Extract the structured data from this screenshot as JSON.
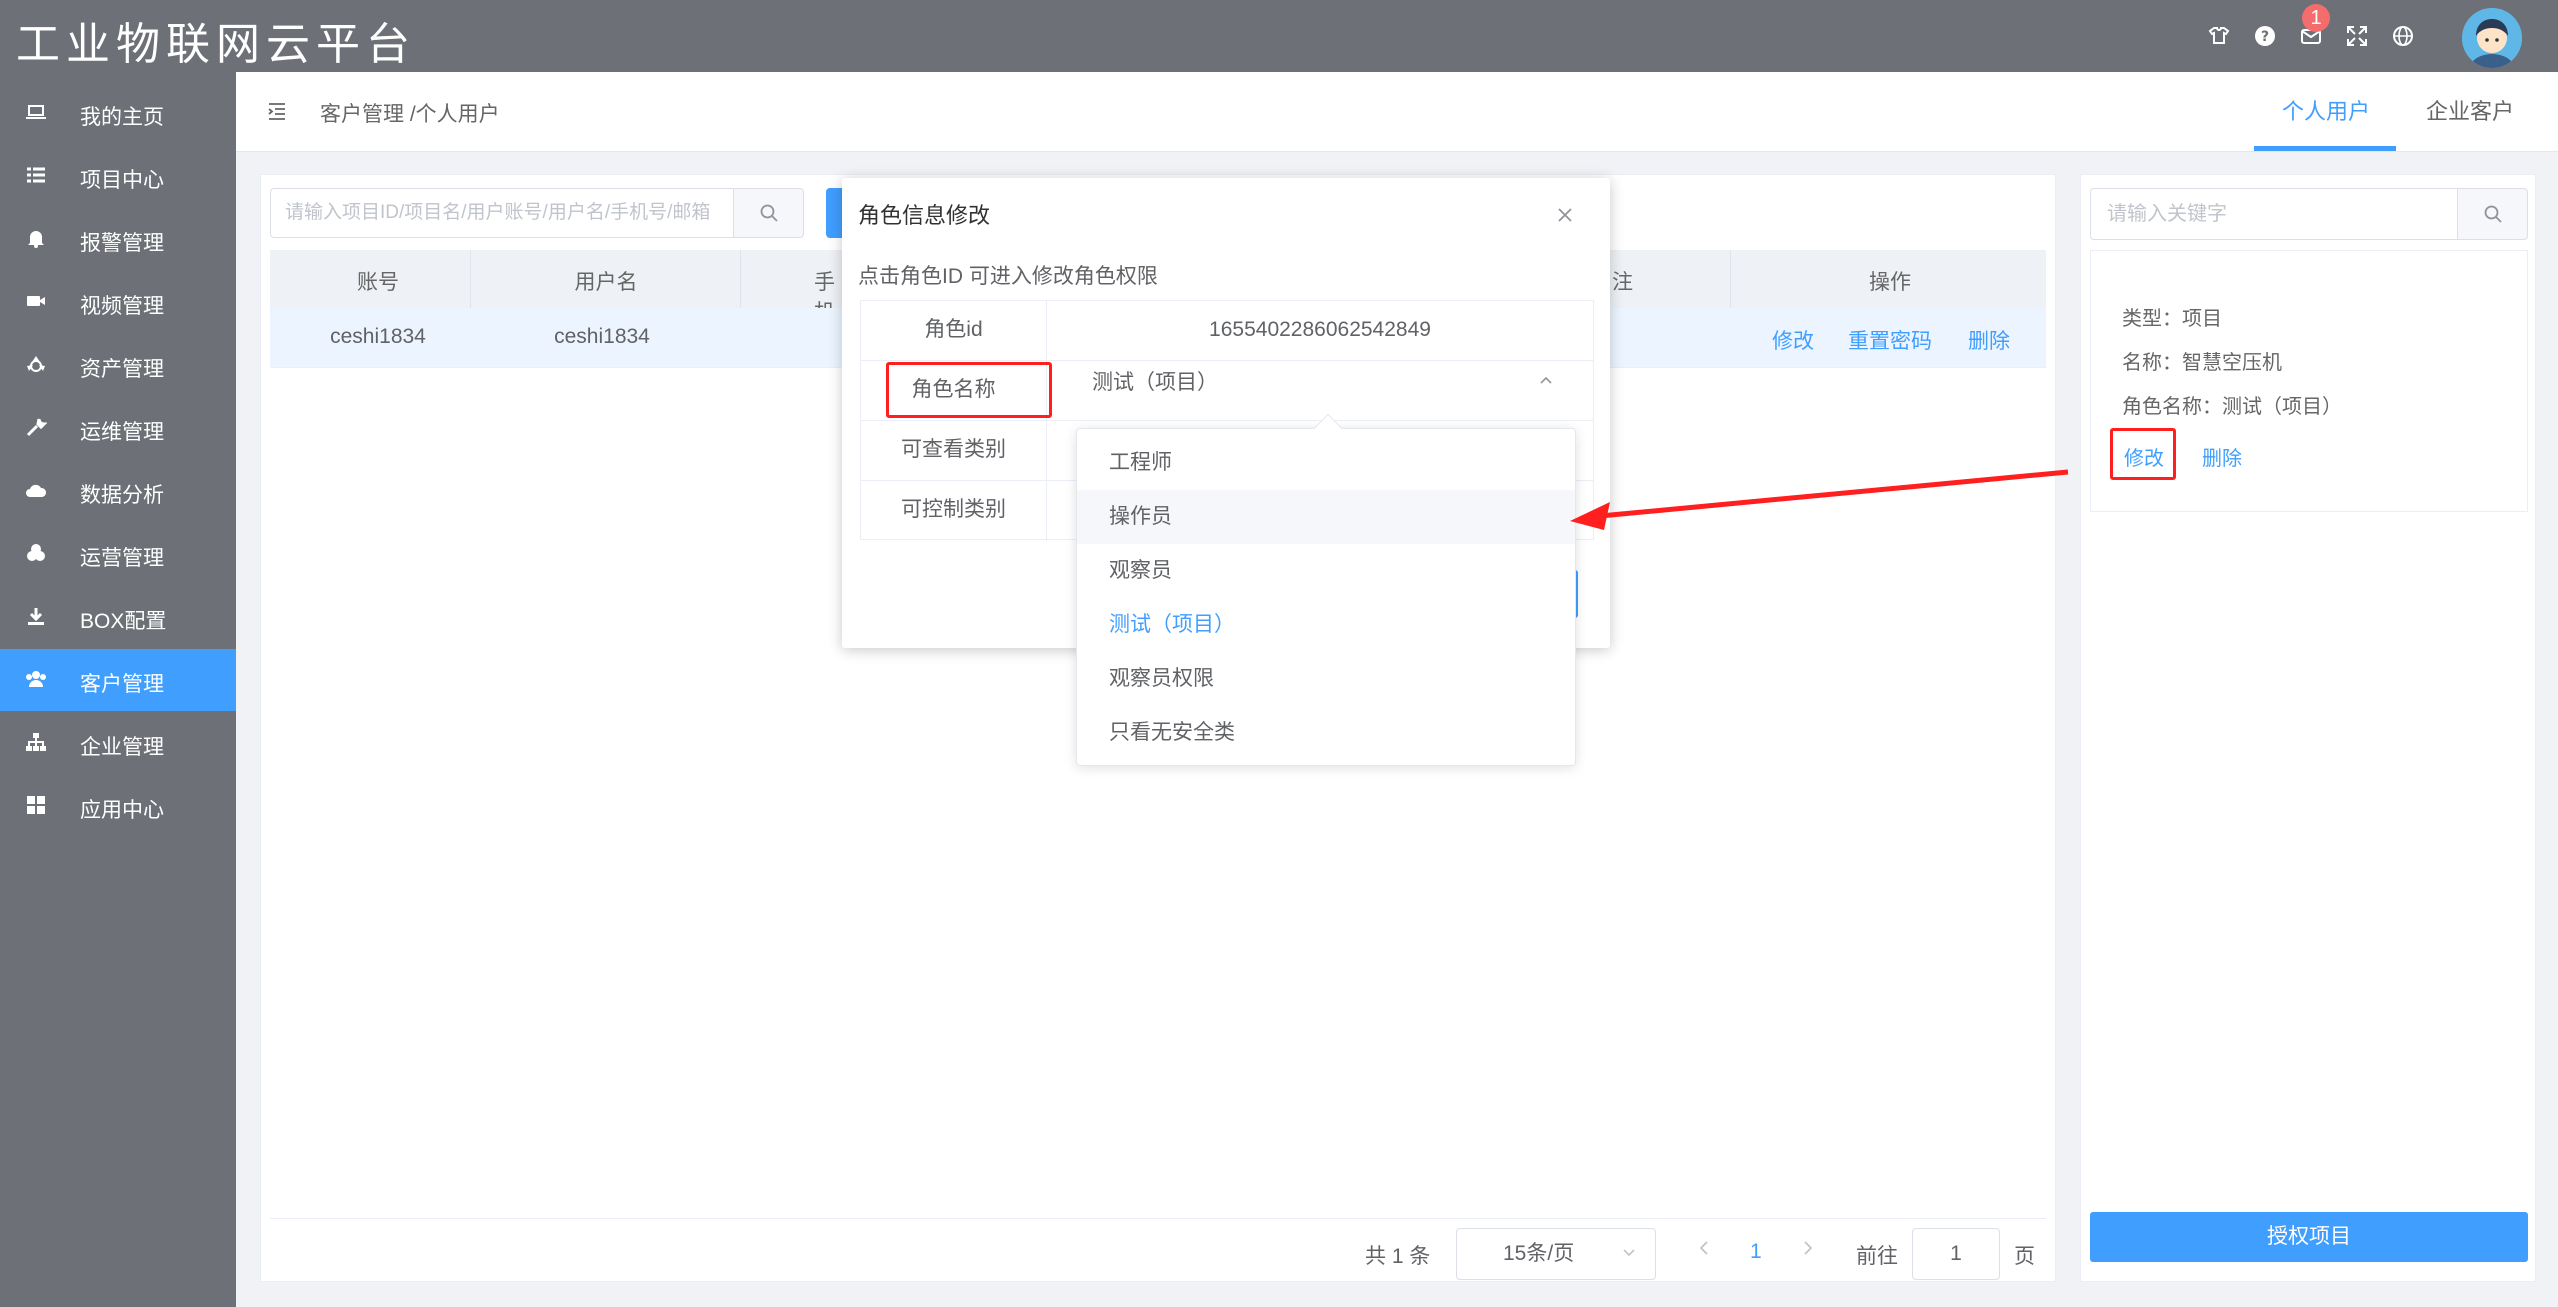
{
  "app": {
    "title": "工业物联网云平台",
    "notification_count": "1"
  },
  "sidebar": {
    "items": [
      {
        "label": "我的主页",
        "icon": "laptop-icon"
      },
      {
        "label": "项目中心",
        "icon": "list-icon"
      },
      {
        "label": "报警管理",
        "icon": "bell-icon"
      },
      {
        "label": "视频管理",
        "icon": "video-icon"
      },
      {
        "label": "资产管理",
        "icon": "recycle-icon"
      },
      {
        "label": "运维管理",
        "icon": "wrench-icon"
      },
      {
        "label": "数据分析",
        "icon": "cloud-chart-icon"
      },
      {
        "label": "运营管理",
        "icon": "cubes-icon"
      },
      {
        "label": "BOX配置",
        "icon": "download-icon"
      },
      {
        "label": "客户管理",
        "icon": "users-icon",
        "active": true
      },
      {
        "label": "企业管理",
        "icon": "sitemap-icon"
      },
      {
        "label": "应用中心",
        "icon": "grid-icon"
      }
    ]
  },
  "topbar": {
    "breadcrumb": "客户管理 /个人用户",
    "tabs": [
      "个人用户",
      "企业客户"
    ]
  },
  "search": {
    "placeholder": "请输入项目ID/项目名/用户账号/用户名/手机号/邮箱"
  },
  "table": {
    "columns": [
      "账号",
      "用户名",
      "手机",
      "注",
      "操作"
    ],
    "rows": [
      {
        "account": "ceshi1834",
        "username": "ceshi1834",
        "actions": [
          "修改",
          "重置密码",
          "删除"
        ]
      }
    ]
  },
  "pagination": {
    "total": "共 1 条",
    "page_size": "15条/页",
    "current": "1",
    "goto_label": "前往",
    "goto_value": "1",
    "page_suffix": "页"
  },
  "right_panel": {
    "search_placeholder": "请输入关键字",
    "type": "类型：项目",
    "name": "名称：智慧空压机",
    "role_name": "角色名称：测试（项目）",
    "edit": "修改",
    "delete": "删除",
    "authorize_button": "授权项目"
  },
  "dialog": {
    "title": "角色信息修改",
    "hint": "点击角色ID 可进入修改角色权限",
    "rows": [
      {
        "label": "角色id",
        "value": "1655402286062542849"
      },
      {
        "label": "角色名称",
        "value": "测试（项目）"
      },
      {
        "label": "可查看类别",
        "value": ""
      },
      {
        "label": "可控制类别",
        "value": ""
      }
    ]
  },
  "dropdown": {
    "options": [
      "工程师",
      "操作员",
      "观察员",
      "测试（项目）",
      "观察员权限",
      "只看无安全类"
    ],
    "hovered": "操作员",
    "selected": "测试（项目）"
  },
  "colors": {
    "primary": "#409eff",
    "header_bg": "#6d7177",
    "annotation_red": "#ff1f1f"
  }
}
